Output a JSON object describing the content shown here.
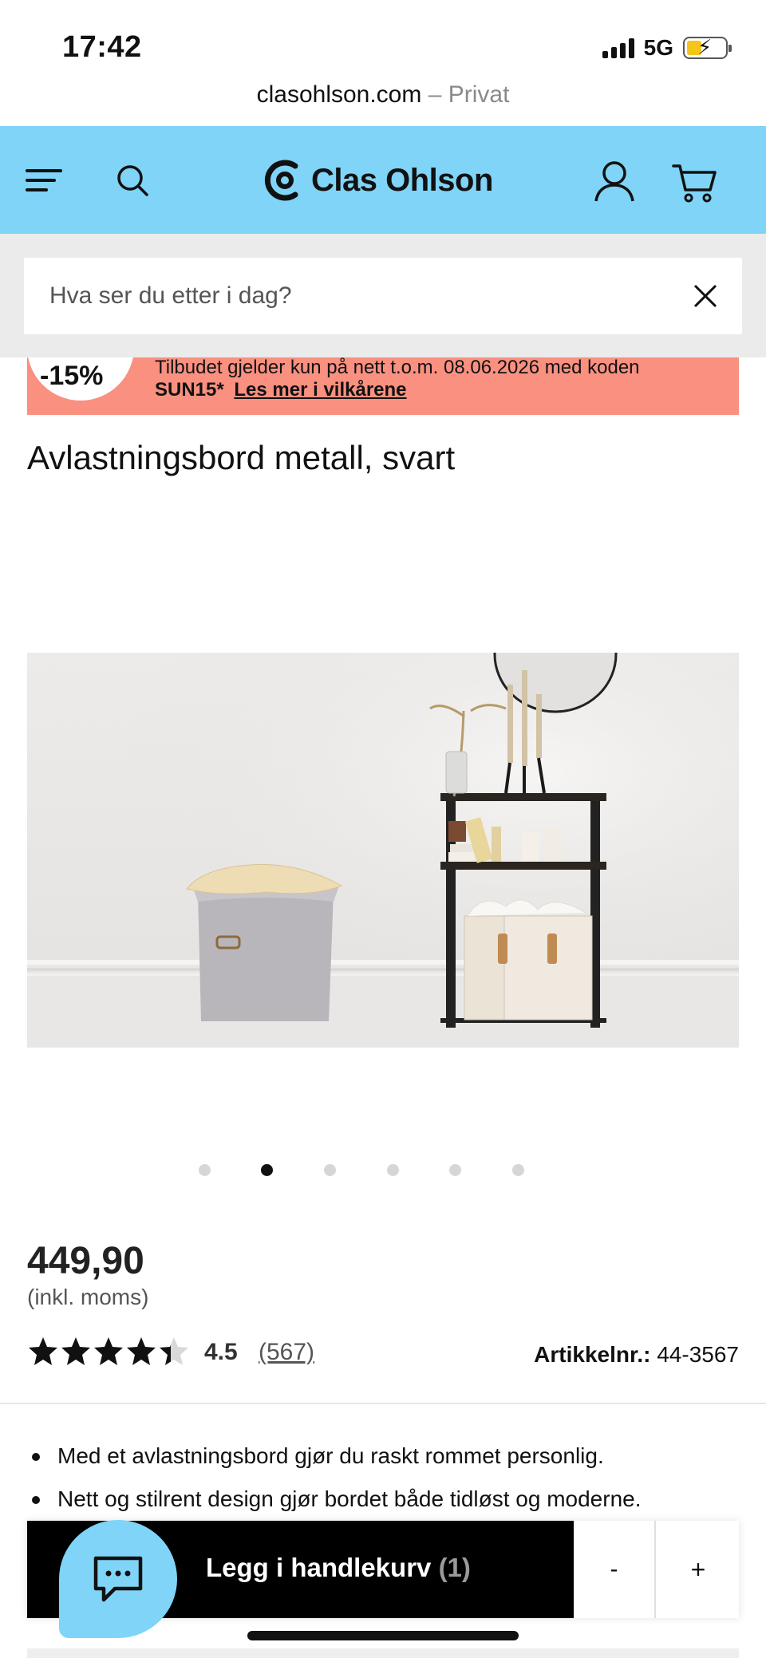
{
  "status_bar": {
    "time": "17:42",
    "network": "5G"
  },
  "browser": {
    "domain": "clasohlson.com",
    "separator": " – ",
    "mode": "Privat"
  },
  "header": {
    "logo_text": "Clas Ohlson"
  },
  "search": {
    "placeholder": "Hva ser du etter i dag?"
  },
  "promo": {
    "badge": "-15%",
    "line1": "Tilbudet gjelder kun på nett t.o.m. 08.06.2026 med koden",
    "code": "SUN15*",
    "link": "Les mer i vilkårene",
    "color": "#f99080"
  },
  "product": {
    "title": "Avlastningsbord metall, svart",
    "price": "449,90",
    "vat_note": "(inkl. moms)",
    "rating": 4.5,
    "rating_text": "4.5",
    "review_count": "(567)",
    "article_label": "Artikkelnr.:",
    "article_number": "44-3567",
    "bullets": [
      "Med et avlastningsbord gjør du raskt rommet personlig.",
      "Nett og stilrent design gjør bordet både tidløst og moderne."
    ]
  },
  "gallery": {
    "count": 6,
    "active_index": 1
  },
  "cart_bar": {
    "add_label": "Legg i handlekurv",
    "quantity": "(1)",
    "minus": "-",
    "plus": "+"
  },
  "colors": {
    "header_bg": "#7fd4f7",
    "accent": "#000000"
  }
}
